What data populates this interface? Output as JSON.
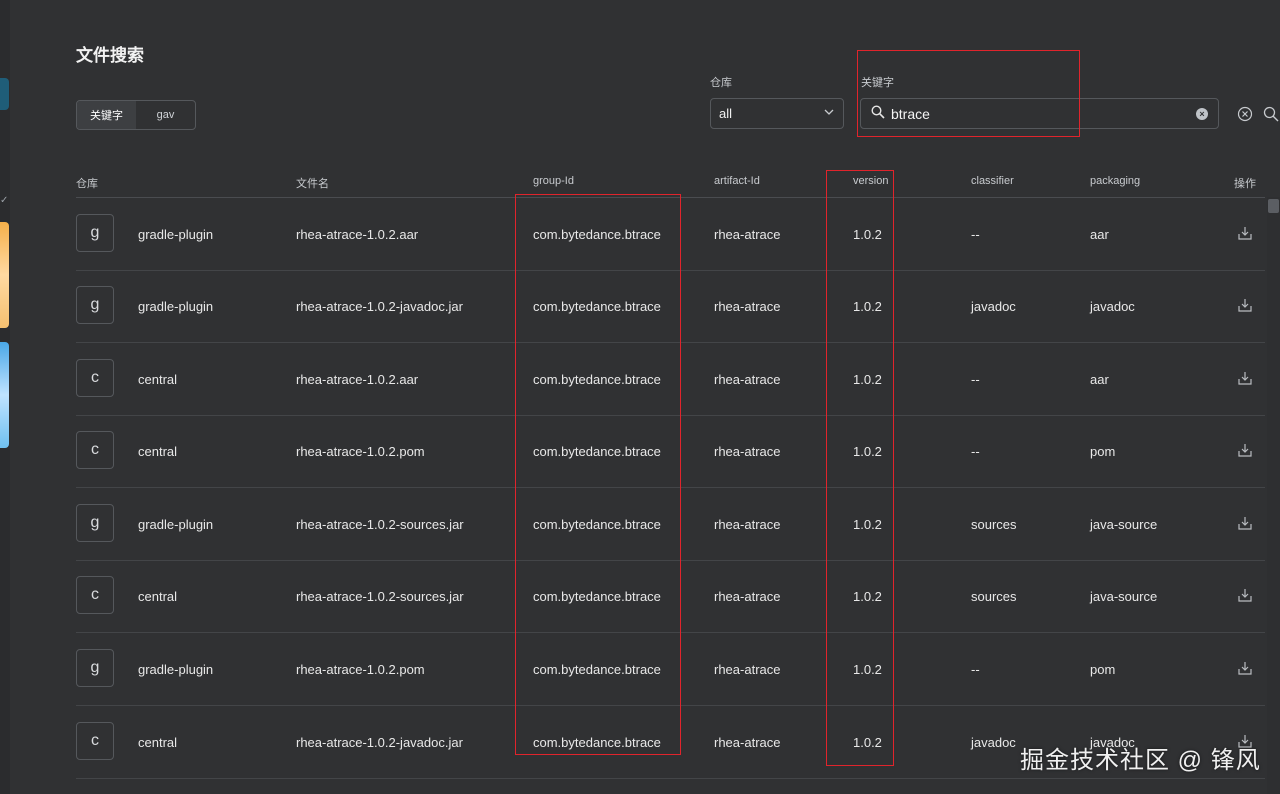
{
  "page_title": "文件搜索",
  "mode_toggle": {
    "options": [
      "关键字",
      "gav"
    ],
    "active_index": 0
  },
  "repository_filter": {
    "label": "仓库",
    "value": "all"
  },
  "keyword_filter": {
    "label": "关键字",
    "value": "btrace"
  },
  "table": {
    "columns": [
      "仓库",
      "文件名",
      "group-Id",
      "artifact-Id",
      "version",
      "classifier",
      "packaging",
      "操作"
    ],
    "rows": [
      {
        "avatar": "g",
        "repo": "gradle-plugin",
        "filename": "rhea-atrace-1.0.2.aar",
        "group_id": "com.bytedance.btrace",
        "artifact_id": "rhea-atrace",
        "version": "1.0.2",
        "classifier": "--",
        "packaging": "aar"
      },
      {
        "avatar": "g",
        "repo": "gradle-plugin",
        "filename": "rhea-atrace-1.0.2-javadoc.jar",
        "group_id": "com.bytedance.btrace",
        "artifact_id": "rhea-atrace",
        "version": "1.0.2",
        "classifier": "javadoc",
        "packaging": "javadoc"
      },
      {
        "avatar": "c",
        "repo": "central",
        "filename": "rhea-atrace-1.0.2.aar",
        "group_id": "com.bytedance.btrace",
        "artifact_id": "rhea-atrace",
        "version": "1.0.2",
        "classifier": "--",
        "packaging": "aar"
      },
      {
        "avatar": "c",
        "repo": "central",
        "filename": "rhea-atrace-1.0.2.pom",
        "group_id": "com.bytedance.btrace",
        "artifact_id": "rhea-atrace",
        "version": "1.0.2",
        "classifier": "--",
        "packaging": "pom"
      },
      {
        "avatar": "g",
        "repo": "gradle-plugin",
        "filename": "rhea-atrace-1.0.2-sources.jar",
        "group_id": "com.bytedance.btrace",
        "artifact_id": "rhea-atrace",
        "version": "1.0.2",
        "classifier": "sources",
        "packaging": "java-source"
      },
      {
        "avatar": "c",
        "repo": "central",
        "filename": "rhea-atrace-1.0.2-sources.jar",
        "group_id": "com.bytedance.btrace",
        "artifact_id": "rhea-atrace",
        "version": "1.0.2",
        "classifier": "sources",
        "packaging": "java-source"
      },
      {
        "avatar": "g",
        "repo": "gradle-plugin",
        "filename": "rhea-atrace-1.0.2.pom",
        "group_id": "com.bytedance.btrace",
        "artifact_id": "rhea-atrace",
        "version": "1.0.2",
        "classifier": "--",
        "packaging": "pom"
      },
      {
        "avatar": "c",
        "repo": "central",
        "filename": "rhea-atrace-1.0.2-javadoc.jar",
        "group_id": "com.bytedance.btrace",
        "artifact_id": "rhea-atrace",
        "version": "1.0.2",
        "classifier": "javadoc",
        "packaging": "javadoc"
      }
    ]
  },
  "watermark": "掘金技术社区 @ 锋风",
  "colors": {
    "background": "#303133",
    "link": "#4db8ea",
    "annotation": "#e0242c"
  }
}
